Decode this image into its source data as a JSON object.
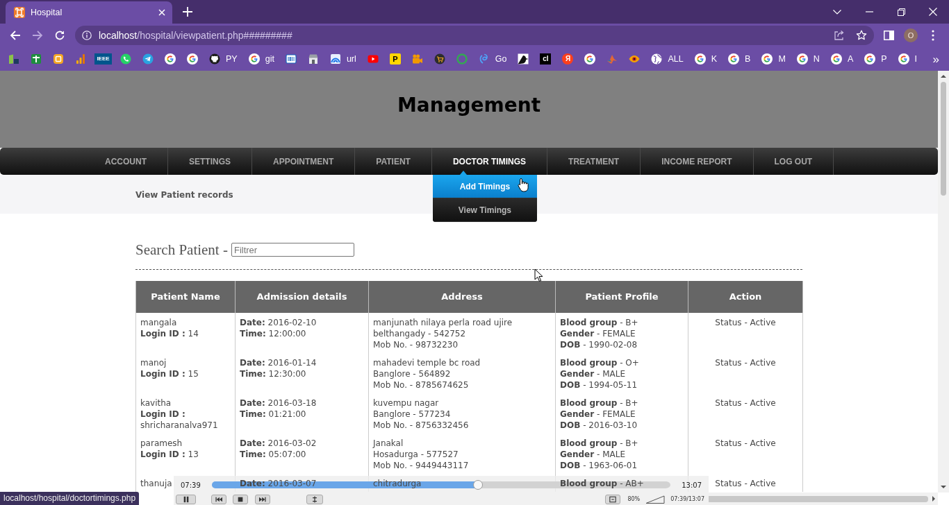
{
  "browser": {
    "tab_title": "Hospital",
    "url": {
      "host": "localhost",
      "path": "/hospital/viewpatient.php#########"
    },
    "profile_initial": "O",
    "bookmarks": [
      {
        "kind": "blocks"
      },
      {
        "kind": "cross"
      },
      {
        "kind": "badge"
      },
      {
        "kind": "chart"
      },
      {
        "kind": "ieee",
        "glyph": "IEEE"
      },
      {
        "kind": "chat"
      },
      {
        "kind": "plane"
      },
      {
        "kind": "google"
      },
      {
        "kind": "google"
      },
      {
        "kind": "octo",
        "label": "PY"
      },
      {
        "kind": "google",
        "label": "git"
      },
      {
        "kind": "barcode"
      },
      {
        "kind": "store"
      },
      {
        "kind": "wave",
        "label": "url"
      },
      {
        "kind": "play"
      },
      {
        "kind": "tile",
        "glyph": "P"
      },
      {
        "kind": "camera"
      },
      {
        "kind": "cart"
      },
      {
        "kind": "ring"
      },
      {
        "kind": "swirl",
        "label": "Go"
      },
      {
        "kind": "bird"
      },
      {
        "kind": "darktile",
        "glyph": "cl"
      },
      {
        "kind": "roundel",
        "glyph": "Я"
      },
      {
        "kind": "google"
      },
      {
        "kind": "peak"
      },
      {
        "kind": "eye"
      },
      {
        "kind": "globe",
        "label": "ALL"
      },
      {
        "kind": "google",
        "label": "K"
      },
      {
        "kind": "google",
        "label": "B"
      },
      {
        "kind": "google",
        "label": "M"
      },
      {
        "kind": "google",
        "label": "N"
      },
      {
        "kind": "google",
        "label": "A"
      },
      {
        "kind": "google",
        "label": "P"
      },
      {
        "kind": "google",
        "label": "I"
      }
    ],
    "bookmarks_overflow": "»"
  },
  "page": {
    "title": "Management",
    "nav": [
      {
        "label": "ACCOUNT",
        "selected": false
      },
      {
        "label": "SETTINGS",
        "selected": false
      },
      {
        "label": "APPOINTMENT",
        "selected": false
      },
      {
        "label": "PATIENT",
        "selected": false
      },
      {
        "label": "DOCTOR TIMINGS",
        "selected": true,
        "submenu": [
          {
            "label": "Add Timings",
            "selected": true
          },
          {
            "label": "View Timings",
            "selected": false
          }
        ]
      },
      {
        "label": "TREATMENT",
        "selected": false
      },
      {
        "label": "INCOME REPORT",
        "selected": false
      },
      {
        "label": "LOG OUT",
        "selected": false
      }
    ],
    "subheading": "View Patient records",
    "search": {
      "label": "Search Patient -",
      "placeholder": "Filtrer"
    },
    "table": {
      "columns": [
        "Patient Name",
        "Admission details",
        "Address",
        "Patient Profile",
        "Action"
      ],
      "rows": [
        {
          "name": "mangala",
          "login": "**Login ID :** 14",
          "date": "**Date:** 2016-02-10",
          "time": "**Time:** 12:00:00",
          "street": "manjunath nilaya perla road ujire",
          "city": "belthangady - 542752",
          "mobile": "Mob No. - 98732230",
          "blood_group": "**Blood group** - B+",
          "gender": "**Gender** - FEMALE",
          "dob": "**DOB** - 1990-02-08",
          "status": "Status - Active"
        },
        {
          "name": "manoj",
          "login": "**Login ID :** 15",
          "date": "**Date:** 2016-01-14",
          "time": "**Time:** 12:30:00",
          "street": "mahadevi temple bc road",
          "city": "Banglore - 564892",
          "mobile": "Mob No. - 8785674625",
          "blood_group": "**Blood group** - O+",
          "gender": "**Gender** - MALE",
          "dob": "**DOB** - 1994-05-11",
          "status": "Status - Active"
        },
        {
          "name": "kavitha",
          "login": "**Login ID :** shricharanalva971",
          "date": "**Date:** 2016-03-18",
          "time": "**Time:** 01:21:00",
          "street": "kuvempu nagar",
          "city": "Banglore - 577234",
          "mobile": "Mob No. - 8756332456",
          "blood_group": "**Blood group** - B+",
          "gender": "**Gender** - FEMALE",
          "dob": "**DOB** - 2016-03-10",
          "status": "Status - Active"
        },
        {
          "name": "paramesh",
          "login": "**Login ID :** 13",
          "date": "**Date:** 2016-03-02",
          "time": "**Time:** 05:07:00",
          "street": "Janakal",
          "city": "Hosadurga - 577527",
          "mobile": "Mob No. - 9449443117",
          "blood_group": "**Blood group** - B+",
          "gender": "**Gender** - MALE",
          "dob": "**DOB** - 1963-06-01",
          "status": "Status - Active"
        },
        {
          "name": "thanuja",
          "date": "**Date:** 2016-03-07",
          "street": "chitradurga",
          "blood_group": "**Blood group** - AB+",
          "status": "Status - Active"
        }
      ]
    }
  },
  "video_player": {
    "elapsed": "07:39",
    "total": "13:07",
    "level": 0.58,
    "volume": "80%",
    "time_readout": "07:39/13:07"
  },
  "status_bar": {
    "link": "localhost/hospital/doctortimings.php"
  }
}
